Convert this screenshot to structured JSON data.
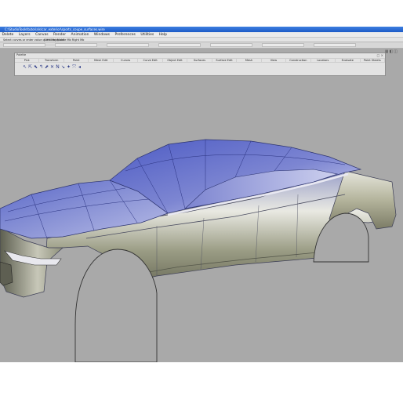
{
  "window": {
    "title": "C:\\StudioTools\\tutorials\\car_exterior\\sports_coupe_surfaces.wire",
    "accent_color": "#2a6bd6"
  },
  "menu": {
    "items": [
      "Delete",
      "Layers",
      "Canvas",
      "Render",
      "Animation",
      "Windows",
      "Preferences",
      "Utilities",
      "Help"
    ]
  },
  "prompt": {
    "text": "Select curves or enter value of first endpoint",
    "coords": "(Left Mb) Middle Mb Right Mb"
  },
  "palette": {
    "title": "Palette",
    "close_label": "□ ×",
    "tabs": [
      "Pick",
      "Transform",
      "Point",
      "Mesh Edit",
      "Curves",
      "Curve Edit",
      "Object Edit",
      "Surfaces",
      "Surface Edit",
      "Mesh",
      "View",
      "Construction",
      "Locators",
      "Evaluate",
      "Paint Sheets"
    ],
    "tool_icons": [
      "pick-arrow-icon",
      "pick-object-icon",
      "pick-cv-icon",
      "pick-curve-icon",
      "pick-surface-icon",
      "pick-point-icon",
      "pick-template-icon",
      "pick-nothing-icon",
      "pick-light-icon",
      "pick-edit-icon",
      "pick-shader-icon"
    ]
  },
  "view_controls": {
    "icons": [
      "grid-icon",
      "layer-icon",
      "camera-icon"
    ]
  },
  "viewport": {
    "background_color": "#a9a9a9",
    "model": "car-body-surface-model"
  }
}
